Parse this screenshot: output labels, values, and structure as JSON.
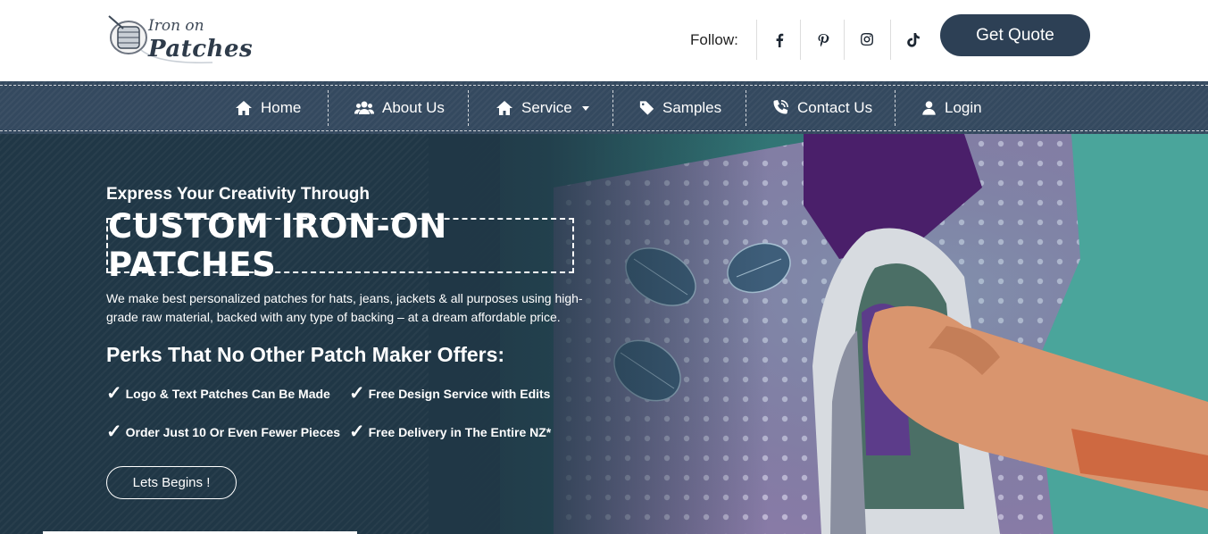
{
  "header": {
    "logo": {
      "line1": "Iron on",
      "line2": "Patches"
    },
    "follow_label": "Follow:",
    "social": [
      {
        "icon": "facebook-icon"
      },
      {
        "icon": "pinterest-icon"
      },
      {
        "icon": "instagram-icon"
      },
      {
        "icon": "tiktok-icon"
      }
    ],
    "quote_button": "Get Quote"
  },
  "nav": {
    "items": [
      {
        "label": "Home",
        "icon": "home-icon"
      },
      {
        "label": "About Us",
        "icon": "users-icon"
      },
      {
        "label": "Service",
        "icon": "home-icon",
        "has_dropdown": true
      },
      {
        "label": "Samples",
        "icon": "tag-icon"
      },
      {
        "label": "Contact Us",
        "icon": "phone-icon"
      },
      {
        "label": "Login",
        "icon": "user-icon"
      }
    ]
  },
  "hero": {
    "kicker": "Express Your Creativity Through",
    "title": "CUSTOM IRON-ON PATCHES",
    "description": "We make best personalized patches for hats, jeans, jackets & all purposes using high-grade raw material, backed with any type of backing – at a dream affordable price.",
    "perks_title": "Perks That No Other Patch Maker Offers:",
    "check_mark": "✓",
    "perks": [
      "Logo & Text Patches Can Be Made",
      "Free Design Service with Edits",
      "Order Just 10 Or Even Fewer Pieces",
      "Free Delivery in The Entire NZ*"
    ],
    "cta": "Lets Begins !",
    "slider_progress": 0.26
  },
  "colors": {
    "brand_dark": "#2d4055",
    "nav_bg": "#34495f",
    "hero_bg": "#203746"
  }
}
